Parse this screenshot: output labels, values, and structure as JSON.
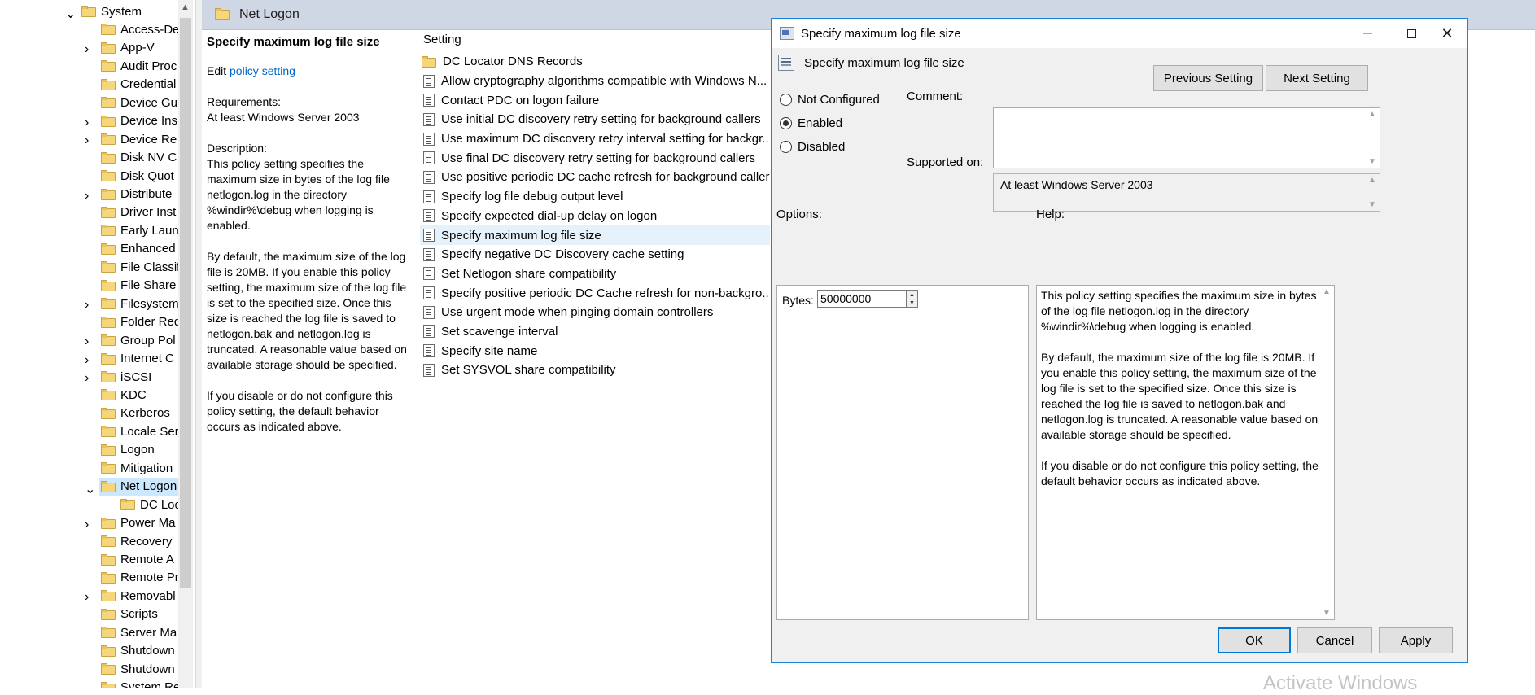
{
  "tree": {
    "items": [
      {
        "label": "System",
        "expand": "expanded",
        "indent": 0
      },
      {
        "label": "Access-De",
        "expand": "none",
        "indent": 1
      },
      {
        "label": "App-V",
        "expand": "collapsed",
        "indent": 1
      },
      {
        "label": "Audit Proc",
        "expand": "none",
        "indent": 1
      },
      {
        "label": "Credential",
        "expand": "none",
        "indent": 1
      },
      {
        "label": "Device Gu",
        "expand": "none",
        "indent": 1
      },
      {
        "label": "Device Ins",
        "expand": "collapsed",
        "indent": 1
      },
      {
        "label": "Device Re",
        "expand": "collapsed",
        "indent": 1
      },
      {
        "label": "Disk NV C",
        "expand": "none",
        "indent": 1
      },
      {
        "label": "Disk Quot",
        "expand": "none",
        "indent": 1
      },
      {
        "label": "Distribute",
        "expand": "collapsed",
        "indent": 1
      },
      {
        "label": "Driver Inst",
        "expand": "none",
        "indent": 1
      },
      {
        "label": "Early Laun",
        "expand": "none",
        "indent": 1
      },
      {
        "label": "Enhanced",
        "expand": "none",
        "indent": 1
      },
      {
        "label": "File Classif",
        "expand": "none",
        "indent": 1
      },
      {
        "label": "File Share",
        "expand": "none",
        "indent": 1
      },
      {
        "label": "Filesystem",
        "expand": "collapsed",
        "indent": 1
      },
      {
        "label": "Folder Red",
        "expand": "none",
        "indent": 1
      },
      {
        "label": "Group Pol",
        "expand": "collapsed",
        "indent": 1
      },
      {
        "label": "Internet C",
        "expand": "collapsed",
        "indent": 1
      },
      {
        "label": "iSCSI",
        "expand": "collapsed",
        "indent": 1
      },
      {
        "label": "KDC",
        "expand": "none",
        "indent": 1
      },
      {
        "label": "Kerberos",
        "expand": "none",
        "indent": 1
      },
      {
        "label": "Locale Ser",
        "expand": "none",
        "indent": 1
      },
      {
        "label": "Logon",
        "expand": "none",
        "indent": 1
      },
      {
        "label": "Mitigation",
        "expand": "none",
        "indent": 1
      },
      {
        "label": "Net Logon",
        "expand": "expanded",
        "indent": 1,
        "selected": true
      },
      {
        "label": "DC Loc",
        "expand": "none",
        "indent": 2
      },
      {
        "label": "Power Ma",
        "expand": "collapsed",
        "indent": 1
      },
      {
        "label": "Recovery",
        "expand": "none",
        "indent": 1
      },
      {
        "label": "Remote A",
        "expand": "none",
        "indent": 1
      },
      {
        "label": "Remote Pr",
        "expand": "none",
        "indent": 1
      },
      {
        "label": "Removabl",
        "expand": "collapsed",
        "indent": 1
      },
      {
        "label": "Scripts",
        "expand": "none",
        "indent": 1
      },
      {
        "label": "Server Ma",
        "expand": "none",
        "indent": 1
      },
      {
        "label": "Shutdown",
        "expand": "none",
        "indent": 1
      },
      {
        "label": "Shutdown",
        "expand": "none",
        "indent": 1
      },
      {
        "label": "System Re",
        "expand": "none",
        "indent": 1
      }
    ]
  },
  "header": {
    "title": "Net Logon"
  },
  "description": {
    "policy_title": "Specify maximum log file size",
    "edit_prefix": "Edit ",
    "edit_link": "policy setting",
    "requirements_label": "Requirements:",
    "requirements_value": "At least Windows Server 2003",
    "description_label": "Description:",
    "paragraphs": [
      "This policy setting specifies the maximum size in bytes of the log file netlogon.log in the directory %windir%\\debug when logging is enabled.",
      "By default, the maximum size of the log file is 20MB. If you enable this policy setting, the maximum size of the log file is set to the specified size. Once this size is reached the log file is saved to netlogon.bak and netlogon.log is truncated. A reasonable value based on available storage should be specified.",
      "If you disable or do not configure this policy setting, the default behavior occurs as indicated above."
    ]
  },
  "settings": {
    "column_header": "Setting",
    "items": [
      {
        "label": "DC Locator DNS Records",
        "kind": "folder"
      },
      {
        "label": "Allow cryptography algorithms compatible with Windows N...",
        "kind": "setting"
      },
      {
        "label": "Contact PDC on logon failure",
        "kind": "setting"
      },
      {
        "label": "Use initial DC discovery retry setting for background callers",
        "kind": "setting"
      },
      {
        "label": "Use maximum DC discovery retry interval setting for backgr...",
        "kind": "setting"
      },
      {
        "label": "Use final DC discovery retry setting for background callers",
        "kind": "setting"
      },
      {
        "label": "Use positive periodic DC cache refresh for background callers",
        "kind": "setting"
      },
      {
        "label": "Specify log file debug output level",
        "kind": "setting"
      },
      {
        "label": "Specify expected dial-up delay on logon",
        "kind": "setting"
      },
      {
        "label": "Specify maximum log file size",
        "kind": "setting",
        "selected": true
      },
      {
        "label": "Specify negative DC Discovery cache setting",
        "kind": "setting"
      },
      {
        "label": "Set Netlogon share compatibility",
        "kind": "setting"
      },
      {
        "label": "Specify positive periodic DC Cache refresh for non-backgro...",
        "kind": "setting"
      },
      {
        "label": "Use urgent mode when pinging domain controllers",
        "kind": "setting"
      },
      {
        "label": "Set scavenge interval",
        "kind": "setting"
      },
      {
        "label": "Specify site name",
        "kind": "setting"
      },
      {
        "label": "Set SYSVOL share compatibility",
        "kind": "setting"
      }
    ]
  },
  "dialog": {
    "window_title": "Specify maximum log file size",
    "policy_name": "Specify maximum log file size",
    "prev_button": "Previous Setting",
    "next_button": "Next Setting",
    "radio": {
      "not_configured": "Not Configured",
      "enabled": "Enabled",
      "disabled": "Disabled",
      "selected": "enabled"
    },
    "comment_label": "Comment:",
    "comment_value": "",
    "supported_label": "Supported on:",
    "supported_value": "At least Windows Server 2003",
    "options_label": "Options:",
    "help_label": "Help:",
    "bytes_label": "Bytes:",
    "bytes_value": "50000000",
    "help_paragraphs": [
      "This policy setting specifies the maximum size in bytes of the log file netlogon.log in the directory %windir%\\debug when logging is enabled.",
      "By default, the maximum size of the log file is 20MB. If you enable this policy setting, the maximum size of the log file is set to the specified size.  Once this size is reached the log file is saved to netlogon.bak and netlogon.log is truncated. A reasonable value based on available storage should be specified.",
      "If you disable or do not configure this policy setting, the default behavior occurs as indicated above."
    ],
    "ok_button": "OK",
    "cancel_button": "Cancel",
    "apply_button": "Apply"
  },
  "watermark": "Activate Windows",
  "colors": {
    "accent": "#0078d7",
    "header_bg": "#cfd7e4",
    "selected_tree": "#cce8ff",
    "folder": "#f5d67a"
  }
}
